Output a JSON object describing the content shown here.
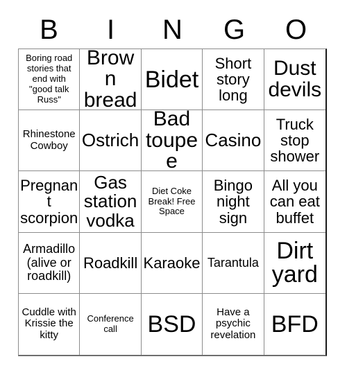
{
  "header": {
    "letters": [
      "B",
      "I",
      "N",
      "G",
      "O"
    ]
  },
  "grid": {
    "columns": 5,
    "rows": 5,
    "cells": [
      {
        "text": "Boring road stories that end with \"good talk Russ\"",
        "size": "fs-xxs"
      },
      {
        "text": "Brown bread",
        "size": "fs-xl"
      },
      {
        "text": "Bidet",
        "size": "fs-xxl"
      },
      {
        "text": "Short story long",
        "size": "fs-md"
      },
      {
        "text": "Dust devils",
        "size": "fs-xl"
      },
      {
        "text": "Rhinestone Cowboy",
        "size": "fs-xs"
      },
      {
        "text": "Ostrich",
        "size": "fs-lg"
      },
      {
        "text": "Bad toupee",
        "size": "fs-xl"
      },
      {
        "text": "Casino",
        "size": "fs-lg"
      },
      {
        "text": "Truck stop shower",
        "size": "fs-md"
      },
      {
        "text": "Pregnant scorpion",
        "size": "fs-md"
      },
      {
        "text": "Gas station vodka",
        "size": "fs-lg"
      },
      {
        "text": "Diet Coke Break! Free Space",
        "size": "fs-xxs"
      },
      {
        "text": "Bingo night sign",
        "size": "fs-md"
      },
      {
        "text": "All you can eat buffet",
        "size": "fs-md"
      },
      {
        "text": "Armadillo (alive or roadkill)",
        "size": "fs-sm"
      },
      {
        "text": "Roadkill",
        "size": "fs-md"
      },
      {
        "text": "Karaoke",
        "size": "fs-md"
      },
      {
        "text": "Tarantula",
        "size": "fs-sm"
      },
      {
        "text": "Dirt yard",
        "size": "fs-xxl"
      },
      {
        "text": "Cuddle with Krissie the kitty",
        "size": "fs-xs"
      },
      {
        "text": "Conference call",
        "size": "fs-xxs"
      },
      {
        "text": "BSD",
        "size": "fs-xxl"
      },
      {
        "text": "Have a psychic revelation",
        "size": "fs-xs"
      },
      {
        "text": "BFD",
        "size": "fs-xxl"
      }
    ]
  },
  "colors": {
    "background": "#ffffff",
    "text": "#000000",
    "grid_line": "#8c8c8c",
    "outer_border": "#1a1a1a"
  }
}
